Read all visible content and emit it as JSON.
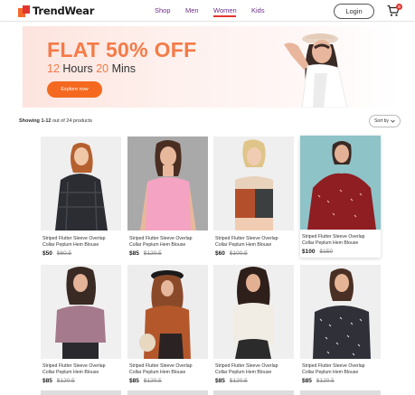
{
  "header": {
    "brand": "TrendWear",
    "nav": [
      "Shop",
      "Men",
      "Women",
      "Kids"
    ],
    "active_nav": "Women",
    "login_label": "Login",
    "cart_count": "0",
    "colors": {
      "accent": "#e2352f",
      "nav": "#6b2e86"
    }
  },
  "banner": {
    "title": "FLAT 50% OFF",
    "timer_hours": "12",
    "timer_hours_label": "Hours",
    "timer_mins": "20",
    "timer_mins_label": "Mins",
    "cta": "Explore now",
    "colors": {
      "headline": "#f47b47",
      "cta": "#f4691f"
    }
  },
  "toolbar": {
    "showing_range": "Showing 1-12",
    "showing_rest": "out of 24 products",
    "sort_label": "Sort by"
  },
  "products": [
    {
      "title_line1": "Striped Flutter Sleeve Overlap",
      "title_line2": "Collar Peplum Hem Blouse",
      "price": "$50",
      "old_price": "$60.5"
    },
    {
      "title_line1": "Striped Flutter Sleeve Overlap",
      "title_line2": "Collar Peplum Hem Blouse",
      "price": "$85",
      "old_price": "$120.5"
    },
    {
      "title_line1": "Striped Flutter Sleeve Overlap",
      "title_line2": "Collar Peplum Hem Blouse",
      "price": "$60",
      "old_price": "$100.5"
    },
    {
      "title_line1": "Striped Flutter Sleeve Overlap",
      "title_line2": "Collar Peplum Hem Blouse",
      "price": "$100",
      "old_price": "$150"
    },
    {
      "title_line1": "Striped Flutter Sleeve Overlap",
      "title_line2": "Collar Peplum Hem Blouse",
      "price": "$85",
      "old_price": "$120.5"
    },
    {
      "title_line1": "Striped Flutter Sleeve Overlap",
      "title_line2": "Collar Peplum Hem Blouse",
      "price": "$85",
      "old_price": "$120.5"
    },
    {
      "title_line1": "Striped Flutter Sleeve Overlap",
      "title_line2": "Collar Peplum Hem Blouse",
      "price": "$85",
      "old_price": "$120.5"
    },
    {
      "title_line1": "Striped Flutter Sleeve Overlap",
      "title_line2": "Collar Peplum Hem Blouse",
      "price": "$85",
      "old_price": "$120.5"
    }
  ]
}
